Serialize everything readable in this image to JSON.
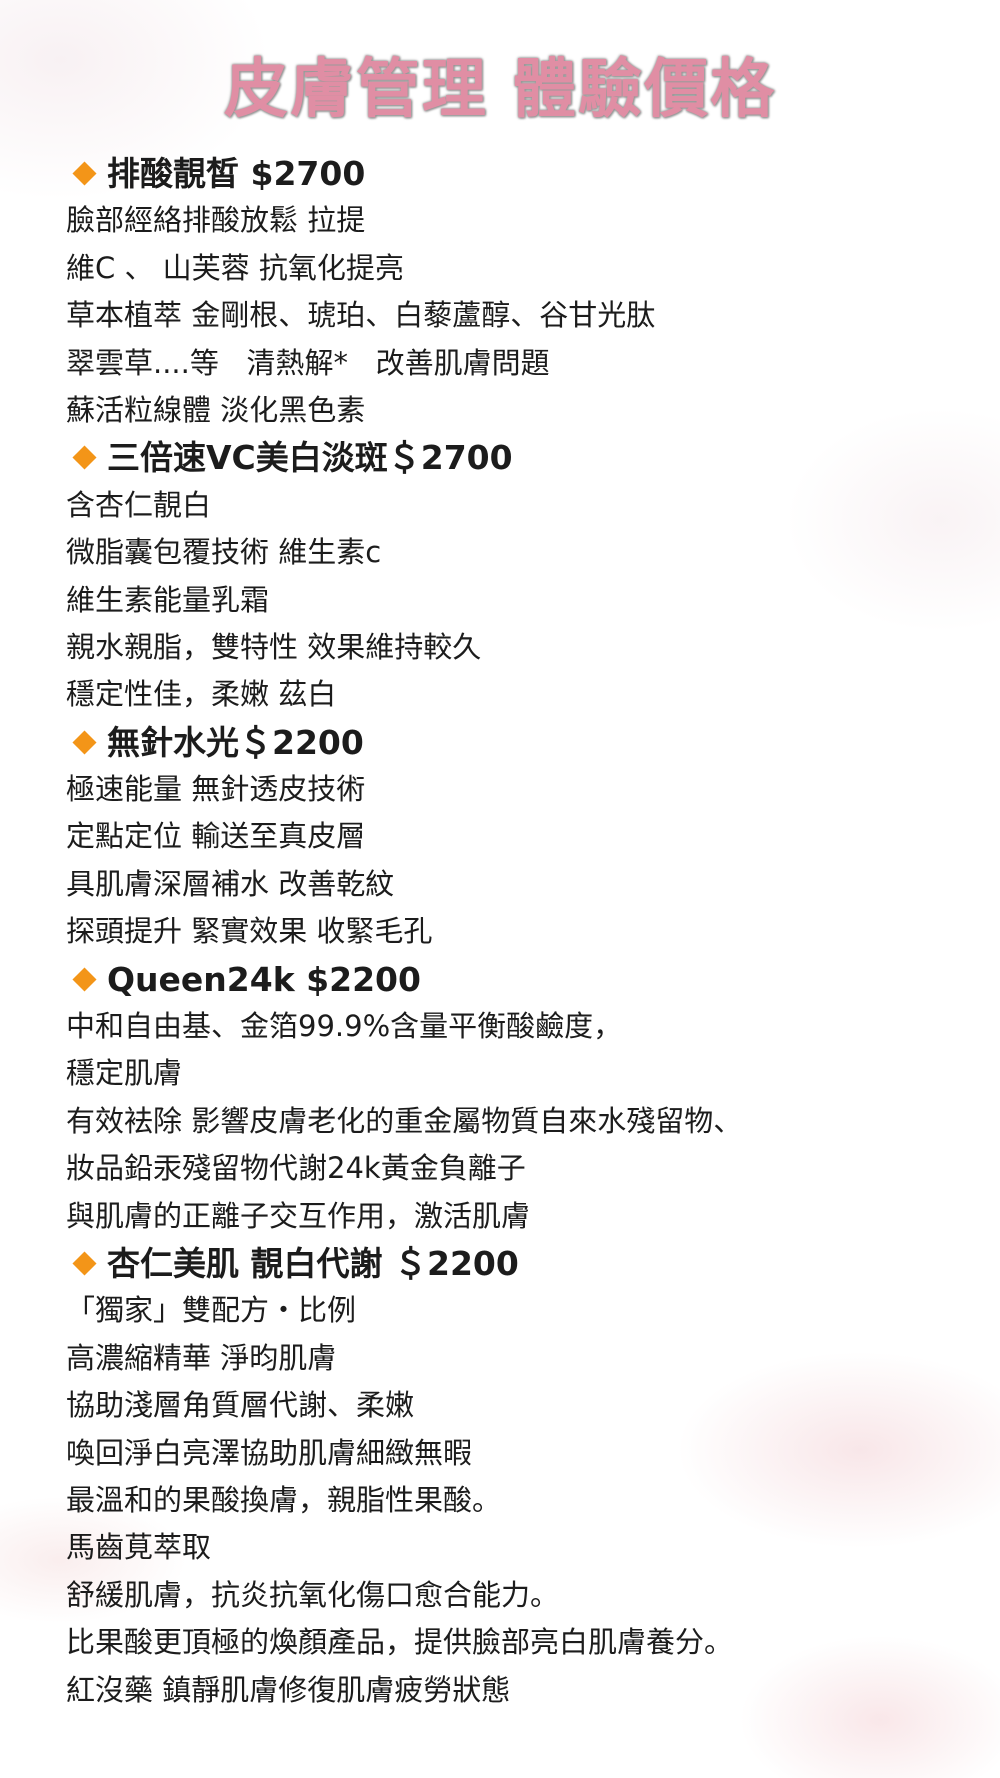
{
  "title": "皮膚管理 體驗價格",
  "sections": [
    {
      "heading": "排酸靚皙 $2700",
      "lines": [
        "臉部經絡排酸放鬆 拉提",
        "維C 、 山芙蓉 抗氧化提亮",
        "草本植萃 金剛根、琥珀、白藜蘆醇、谷甘光肽",
        "翠雲草....等   清熱解*   改善肌膚問題",
        "蘇活粒線體 淡化黑色素"
      ]
    },
    {
      "heading": "三倍速VC美白淡斑＄2700",
      "lines": [
        "含杏仁靚白",
        "微脂囊包覆技術 維生素c",
        "維生素能量乳霜",
        "親水親脂，雙特性 效果維持較久",
        "穩定性佳，柔嫩 茲白"
      ]
    },
    {
      "heading": "無針水光＄2200",
      "lines": [
        "極速能量 無針透皮技術",
        "定點定位 輸送至真皮層",
        "具肌膚深層補水 改善乾紋",
        "探頭提升 緊實效果 收緊毛孔"
      ]
    },
    {
      "heading": "Queen24k $2200",
      "lines": [
        "中和自由基、金箔99.9%含量平衡酸鹼度，",
        "穩定肌膚",
        "有效袪除 影響皮膚老化的重金屬物質自來水殘留物、",
        "妝品鉛汞殘留物代謝24k黃金負離子",
        "與肌膚的正離子交互作用，激活肌膚"
      ]
    },
    {
      "heading": "杏仁美肌 靚白代謝 ＄2200",
      "lines": [
        "「獨家」雙配方・比例",
        "高濃縮精華 淨昀肌膚",
        "協助淺層角質層代謝、柔嫩",
        "喚回淨白亮澤協助肌膚細緻無暇",
        "最溫和的果酸換膚，親脂性果酸。",
        "馬齒莧萃取",
        "舒緩肌膚，抗炎抗氧化傷口愈合能力。",
        "比果酸更頂極的煥顏產品，提供臉部亮白肌膚養分。",
        "紅沒藥 鎮靜肌膚修復肌膚疲勞狀態"
      ]
    }
  ],
  "colors": {
    "title": "#e08ea4",
    "bullet": "#f39518",
    "text": "#1c1c1c"
  },
  "icons": {
    "bullet": "orange-diamond-icon"
  }
}
